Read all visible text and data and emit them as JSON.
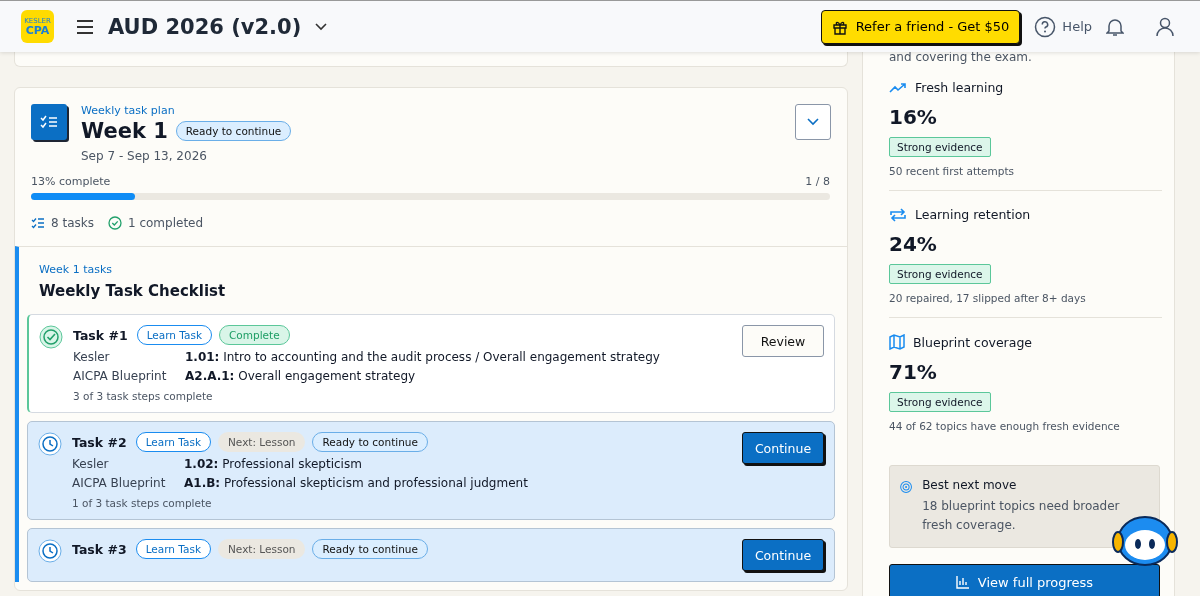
{
  "header": {
    "logo": {
      "line1": "KESLER",
      "line2": "CPA"
    },
    "course": "AUD 2026 (v2.0)",
    "refer_button": "Refer a friend - Get $50",
    "help": "Help"
  },
  "week": {
    "eyebrow": "Weekly task plan",
    "title": "Week 1",
    "status": "Ready to continue",
    "dates": "Sep 7 - Sep 13, 2026",
    "progress_label": "13% complete",
    "progress_count": "1 / 8",
    "level": 0.13,
    "expanded": false,
    "task_count": "8 tasks",
    "completed_count": "1 completed"
  },
  "checklist": {
    "eyebrow": "Week 1 tasks",
    "title": "Weekly Task Checklist",
    "tasks": [
      {
        "kind": "complete",
        "title": "Task #1",
        "tags": [
          {
            "kind": "type",
            "label": "Learn Task"
          },
          {
            "kind": "complete",
            "label": "Complete"
          }
        ],
        "rows": [
          {
            "label": "Kesler",
            "text": "**1.01:** Intro to accounting and the audit process / Overall engagement strategy"
          },
          {
            "label": "AICPA Blueprint",
            "text": "**A2.A.1:** Overall engagement strategy"
          }
        ],
        "steps": "3 of 3 task steps complete",
        "button": "Review"
      },
      {
        "kind": "in_progress",
        "title": "Task #2",
        "tags": [
          {
            "kind": "type",
            "label": "Learn Task"
          },
          {
            "kind": "next",
            "label": "Next: Lesson"
          },
          {
            "kind": "status",
            "label": "Ready to continue"
          }
        ],
        "rows": [
          {
            "label": "Kesler",
            "text": "**1.02:** Professional skepticism"
          },
          {
            "label": "AICPA Blueprint",
            "text": "**A1.B:** Professional skepticism and professional judgment"
          }
        ],
        "steps": "1 of 3 task steps complete",
        "button": "Continue"
      },
      {
        "kind": "in_progress",
        "title": "Task #3",
        "tags": [
          {
            "kind": "type",
            "label": "Learn Task"
          },
          {
            "kind": "next",
            "label": "Next: Lesson"
          },
          {
            "kind": "status",
            "label": "Ready to continue"
          }
        ],
        "button": "Continue"
      }
    ]
  },
  "sidebar": {
    "intro": "and covering the exam.",
    "metrics": [
      {
        "kind": "trend",
        "title": "Fresh learning",
        "value": "16%",
        "badge": "Strong evidence",
        "note": "50 recent first attempts"
      },
      {
        "kind": "repeat",
        "title": "Learning retention",
        "value": "24%",
        "badge": "Strong evidence",
        "note": "20 repaired, 17 slipped after 8+ days"
      },
      {
        "kind": "map",
        "title": "Blueprint coverage",
        "value": "71%",
        "badge": "Strong evidence",
        "note": "44 of 62 topics have enough fresh evidence"
      }
    ],
    "next_move": {
      "title": "Best next move",
      "text": "18 blueprint topics need broader fresh coverage."
    },
    "button": "View full progress"
  }
}
